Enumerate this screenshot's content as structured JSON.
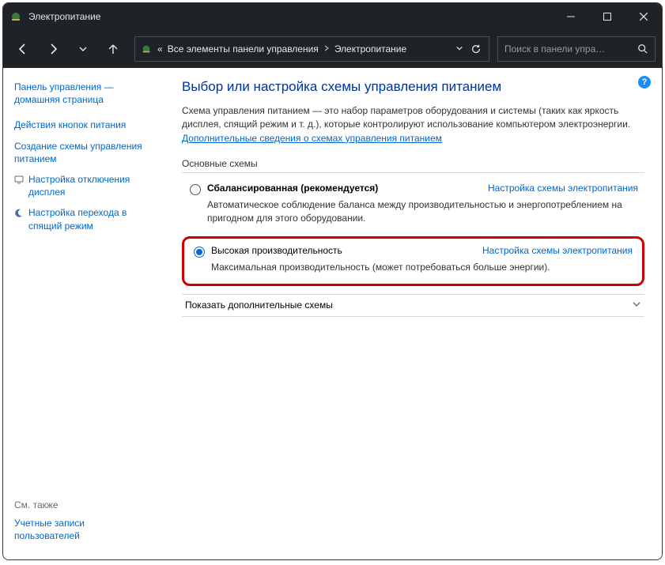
{
  "window": {
    "title": "Электропитание"
  },
  "nav": {
    "breadcrumb_prefix": "«",
    "crumb1": "Все элементы панели управления",
    "crumb2": "Электропитание",
    "search_placeholder": "Поиск в панели упра…"
  },
  "sidebar": {
    "home1": "Панель управления —",
    "home2": "домашняя страница",
    "link_buttons": "Действия кнопок питания",
    "link_create1": "Создание схемы управления",
    "link_create2": "питанием",
    "link_display1": "Настройка отключения",
    "link_display2": "дисплея",
    "link_sleep1": "Настройка перехода в",
    "link_sleep2": "спящий режим",
    "see_also": "См. также",
    "accounts1": "Учетные записи",
    "accounts2": "пользователей"
  },
  "content": {
    "heading": "Выбор или настройка схемы управления питанием",
    "intro_text": "Схема управления питанием — это набор параметров оборудования и системы (таких как яркость дисплея, спящий режим и т. д.), которые контролируют использование компьютером электроэнергии. ",
    "intro_link": "Дополнительные сведения о схемах управления питанием",
    "section_label": "Основные схемы",
    "plan_balanced_title": "Сбалансированная (рекомендуется)",
    "plan_balanced_desc": "Автоматическое соблюдение баланса между производительностью и энергопотреблением на пригодном для этого оборудовании.",
    "plan_high_title": "Высокая производительность",
    "plan_high_desc": "Максимальная производительность (может потребоваться больше энергии).",
    "plan_settings_link": "Настройка схемы электропитания",
    "expand_label": "Показать дополнительные схемы"
  }
}
